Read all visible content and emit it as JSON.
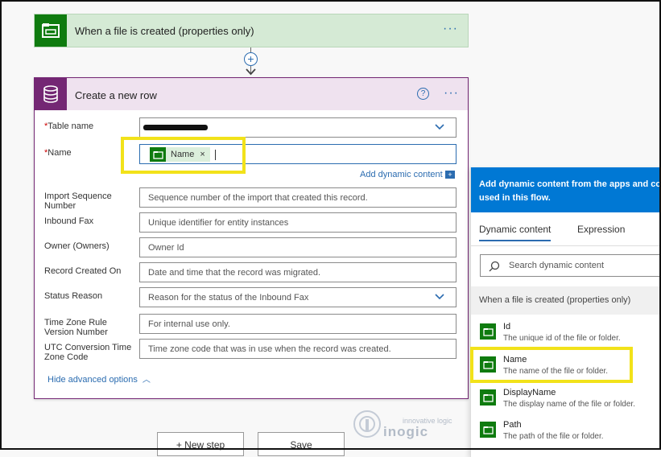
{
  "trigger": {
    "title": "When a file is created (properties only)",
    "more": "···",
    "icon": "sharepoint-folder-icon"
  },
  "connector": {
    "add": "+"
  },
  "action": {
    "title": "Create a new row",
    "help": "?",
    "more": "···",
    "icon": "database-icon",
    "fields": {
      "table_name_label": "Table name",
      "name_label": "Name",
      "name_token": "Name",
      "name_token_remove": "×",
      "add_dynamic_content": "Add dynamic content",
      "add_dynamic_icon": "+",
      "import_seq_label": "Import Sequence Number",
      "import_seq_placeholder": "Sequence number of the import that created this record.",
      "inbound_fax_label": "Inbound Fax",
      "inbound_fax_placeholder": "Unique identifier for entity instances",
      "owner_label": "Owner (Owners)",
      "owner_placeholder": "Owner Id",
      "record_created_label": "Record Created On",
      "record_created_placeholder": "Date and time that the record was migrated.",
      "status_reason_label": "Status Reason",
      "status_reason_placeholder": "Reason for the status of the Inbound Fax",
      "tz_rule_label": "Time Zone Rule Version Number",
      "tz_rule_placeholder": "For internal use only.",
      "utc_label": "UTC Conversion Time Zone Code",
      "utc_placeholder": "Time zone code that was in use when the record was created."
    },
    "hide_advanced": "Hide advanced options"
  },
  "bottom": {
    "new_step": "+ New step",
    "save": "Save"
  },
  "panel": {
    "header": "Add dynamic content from the apps and co used in this flow.",
    "tabs": [
      "Dynamic content",
      "Expression"
    ],
    "search_placeholder": "Search dynamic content",
    "group": "When a file is created (properties only)",
    "items": [
      {
        "name": "Id",
        "desc": "The unique id of the file or folder."
      },
      {
        "name": "Name",
        "desc": "The name of the file or folder."
      },
      {
        "name": "DisplayName",
        "desc": "The display name of the file or folder."
      },
      {
        "name": "Path",
        "desc": "The path of the file or folder."
      }
    ]
  },
  "watermark": {
    "tagline": "innovative logic",
    "brand": "inogic"
  },
  "colors": {
    "accent": "#0078d4",
    "sharepoint": "#0f7b0f",
    "dataverse": "#742774",
    "highlight": "#f2e21a"
  }
}
